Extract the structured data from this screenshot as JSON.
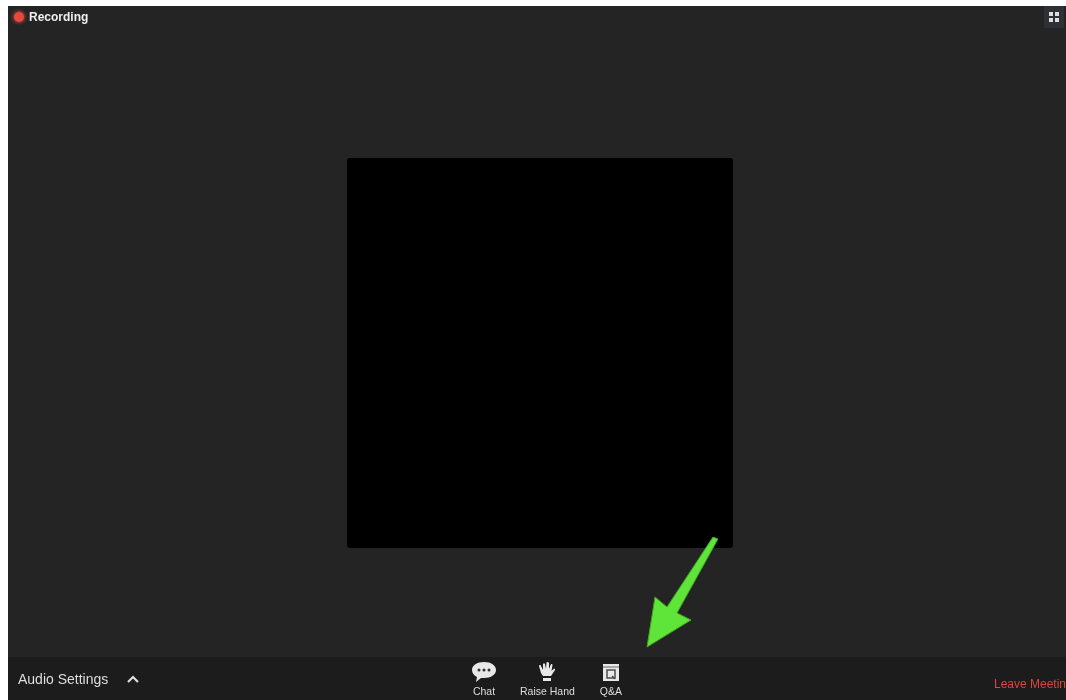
{
  "recording": {
    "label": "Recording",
    "on": true
  },
  "toolbar": {
    "audio_settings": "Audio Settings",
    "actions": [
      {
        "kind": "chat",
        "label": "Chat"
      },
      {
        "kind": "hand",
        "label": "Raise Hand"
      },
      {
        "kind": "qa",
        "label": "Q&A"
      }
    ],
    "leave": "Leave Meetin"
  }
}
